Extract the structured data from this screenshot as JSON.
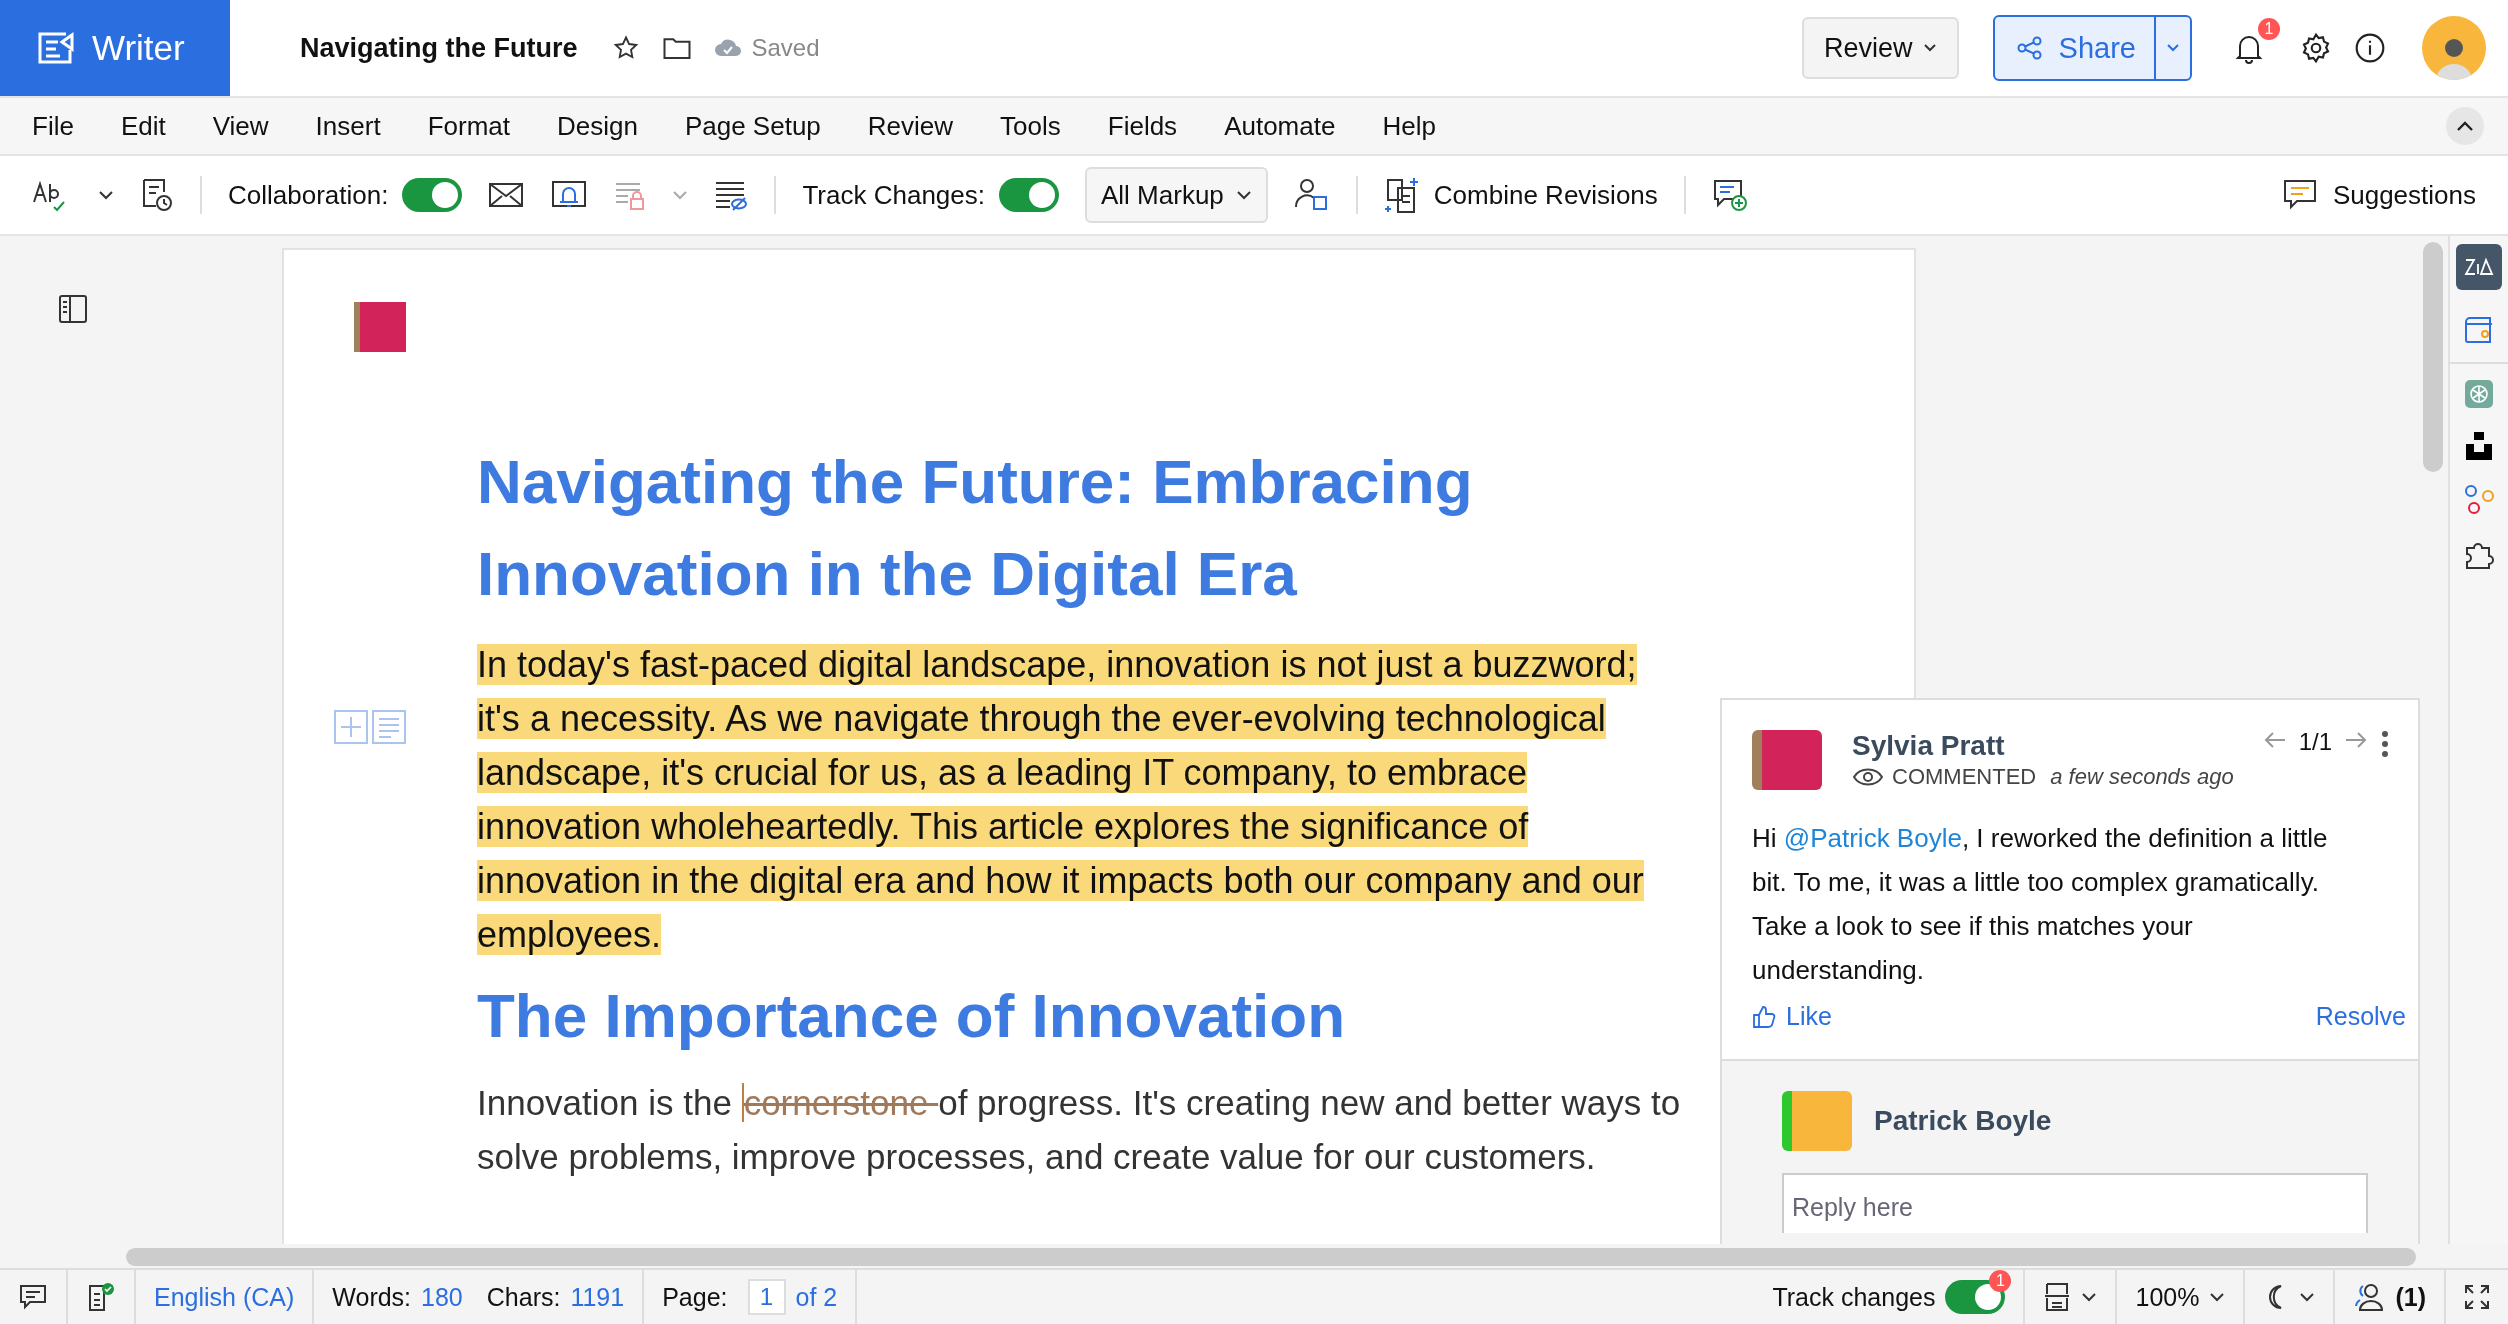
{
  "app": {
    "name": "Writer"
  },
  "document": {
    "title": "Navigating the Future",
    "save_status": "Saved"
  },
  "header": {
    "review": "Review",
    "share": "Share",
    "notification_badge": "1"
  },
  "menu": [
    "File",
    "Edit",
    "View",
    "Insert",
    "Format",
    "Design",
    "Page Setup",
    "Review",
    "Tools",
    "Fields",
    "Automate",
    "Help"
  ],
  "toolbar": {
    "collaboration": {
      "label": "Collaboration:",
      "on": true
    },
    "track_changes": {
      "label": "Track Changes:",
      "on": true
    },
    "markup": "All Markup",
    "combine": "Combine Revisions",
    "suggestions": "Suggestions"
  },
  "page": {
    "heading": "Navigating the Future: Embracing Innovation in the Digital Era",
    "paragraph": "In today's fast-paced digital landscape, innovation is not just a buzzword; it's a necessity. As we navigate through the ever-evolving technological landscape, it's crucial for us, as a leading IT company, to embrace innovation wholeheartedly. This article explores the significance of innovation in the digital era and how it impacts both our company and our employees.",
    "subheading": "The Importance of Innovation",
    "paragraph2": [
      {
        "kind": "text",
        "text": "Innovation is the "
      },
      {
        "kind": "deleted",
        "text": "cornerstone "
      },
      {
        "kind": "text",
        "text": "of progress. It's creating new and better ways to solve problems, improve processes, and create value for our customers."
      }
    ]
  },
  "comment": {
    "author": "Sylvia Pratt",
    "action": "COMMENTED",
    "time": "a few seconds ago",
    "counter": "1/1",
    "greeting": "Hi ",
    "mention": "@Patrick Boyle",
    "body": ", I reworked the definition a little bit. To me, it was a little too complex gramatically. Take a look to see if this matches your understanding.",
    "like": "Like",
    "resolve": "Resolve",
    "reply_author": "Patrick Boyle",
    "reply_placeholder": "Reply here"
  },
  "status_bar": {
    "language": "English (CA)",
    "words_label": "Words:",
    "words": "180",
    "chars_label": "Chars:",
    "chars": "1191",
    "page_label": "Page:",
    "page": "1",
    "page_of": "of 2",
    "track_changes": {
      "label": "Track changes",
      "on": true,
      "badge": "1"
    },
    "zoom": "100%",
    "users": "(1)"
  }
}
